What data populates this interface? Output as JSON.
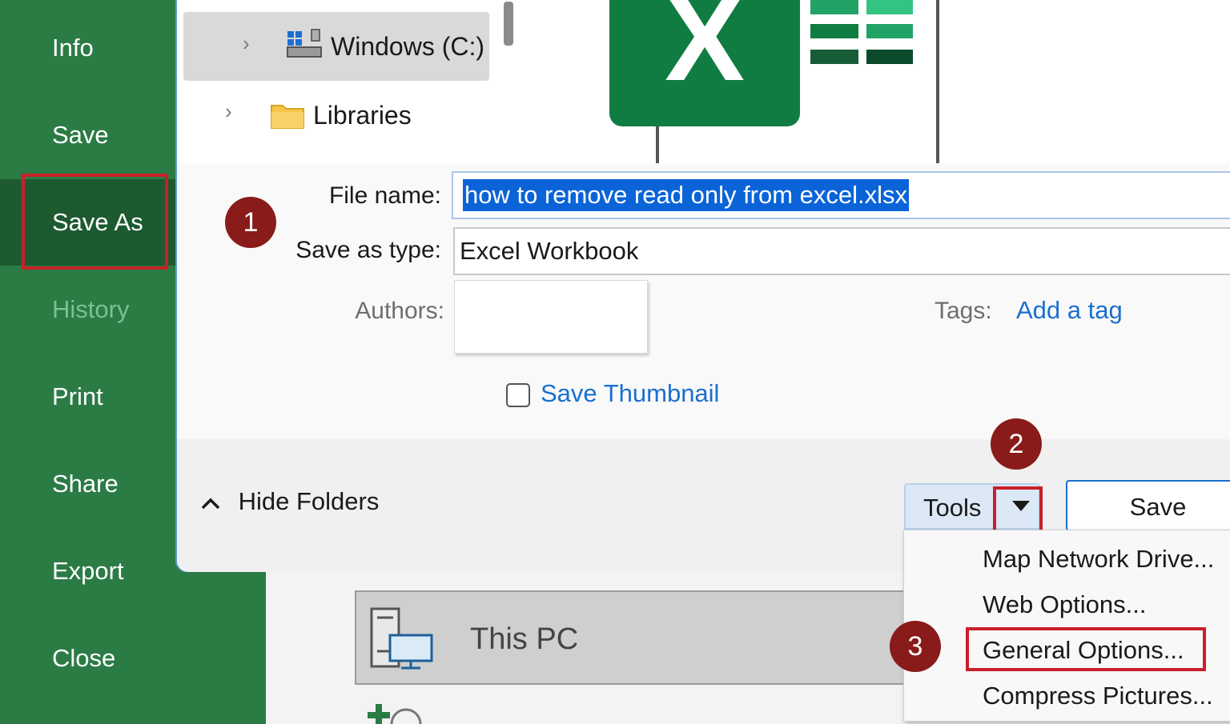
{
  "nav": {
    "items": [
      {
        "label": "Info"
      },
      {
        "label": "Save"
      },
      {
        "label": "Save As"
      },
      {
        "label": "History"
      },
      {
        "label": "Print"
      },
      {
        "label": "Share"
      },
      {
        "label": "Export"
      },
      {
        "label": "Close"
      }
    ]
  },
  "tree": {
    "items": [
      {
        "label": "Windows (C:)",
        "icon": "drive-icon"
      },
      {
        "label": "Libraries",
        "icon": "folder-icon"
      }
    ]
  },
  "form": {
    "file_name_label": "File name:",
    "file_name_value": "how to remove read only from excel.xlsx",
    "save_as_type_label": "Save as type:",
    "save_as_type_value": "Excel Workbook",
    "authors_label": "Authors:",
    "tags_label": "Tags:",
    "tags_link": "Add a tag",
    "thumbnail_label": "Save Thumbnail"
  },
  "footer": {
    "hide_folders": "Hide Folders",
    "tools": "Tools",
    "save": "Save"
  },
  "tools_menu": {
    "items": [
      {
        "label": "Map Network Drive..."
      },
      {
        "label": "Web Options..."
      },
      {
        "label": "General Options..."
      },
      {
        "label": "Compress Pictures..."
      }
    ]
  },
  "backstage": {
    "location_label": "This PC"
  },
  "badges": [
    "1",
    "2",
    "3"
  ],
  "colors": {
    "nav_bg": "#2b7b45",
    "nav_active": "#1d5a30",
    "highlight_red": "#c8202a",
    "badge": "#8a1b1b",
    "link_blue": "#1a6fd0",
    "excel_green": "#107c41"
  }
}
